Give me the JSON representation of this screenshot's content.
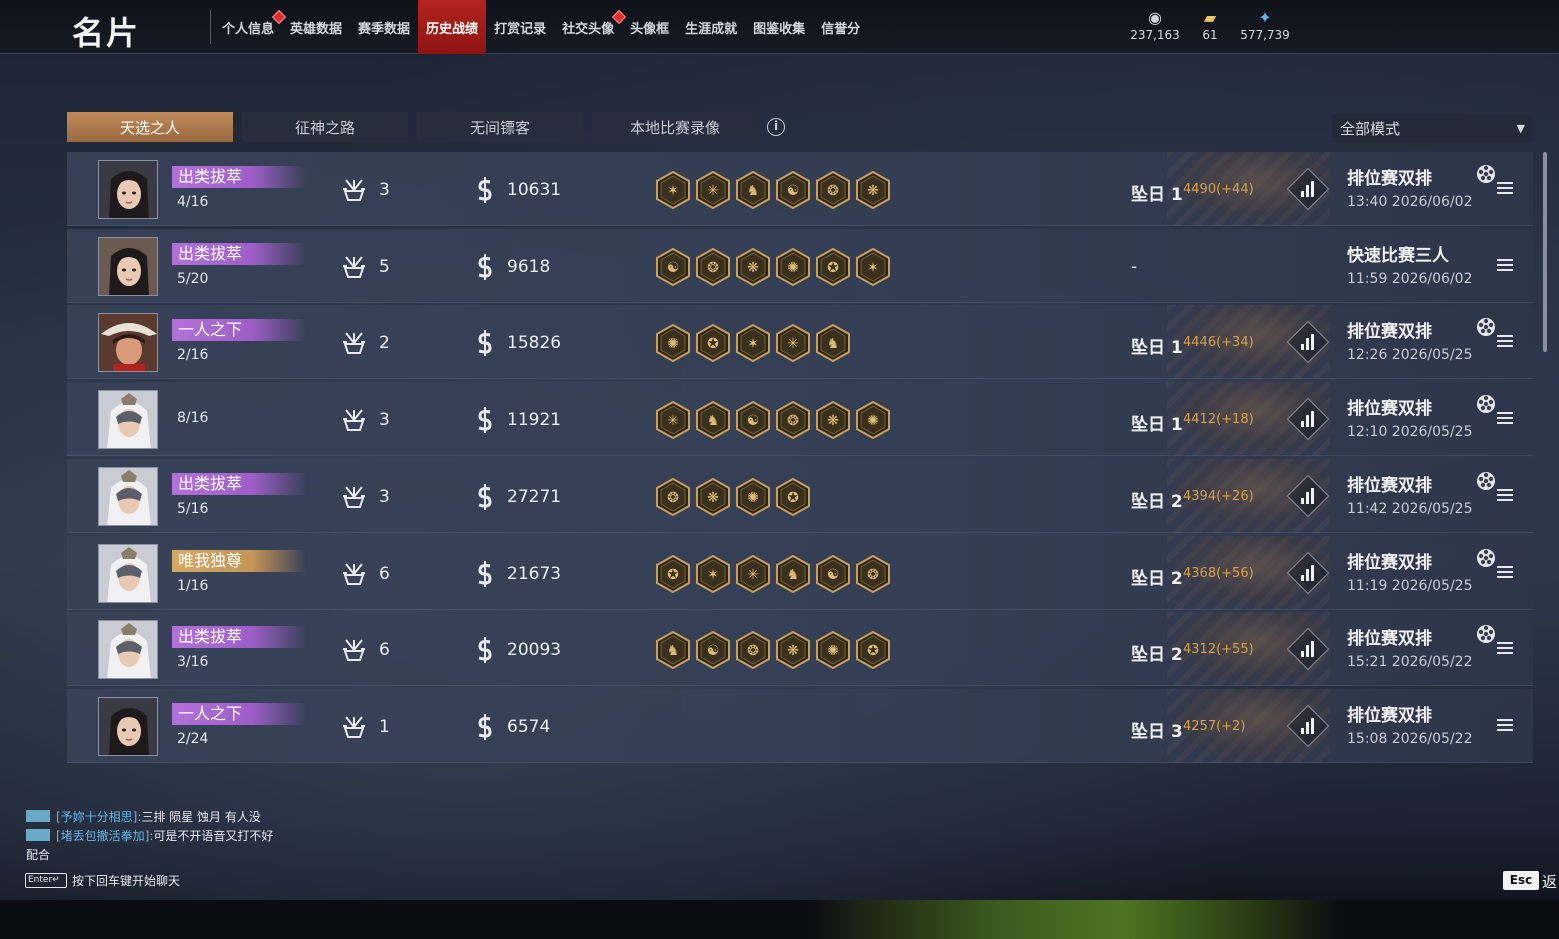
{
  "header": {
    "title": "名片",
    "tabs": [
      {
        "label": "个人信息",
        "badge": true,
        "active": false
      },
      {
        "label": "英雄数据",
        "badge": false,
        "active": false
      },
      {
        "label": "赛季数据",
        "badge": false,
        "active": false
      },
      {
        "label": "历史战绩",
        "badge": false,
        "active": true
      },
      {
        "label": "打赏记录",
        "badge": false,
        "active": false
      },
      {
        "label": "社交头像",
        "badge": true,
        "active": false
      },
      {
        "label": "头像框",
        "badge": false,
        "active": false
      },
      {
        "label": "生涯成就",
        "badge": false,
        "active": false
      },
      {
        "label": "图鉴收集",
        "badge": false,
        "active": false
      },
      {
        "label": "信誉分",
        "badge": false,
        "active": false
      }
    ],
    "currencies": [
      {
        "icon": "gold-coins-icon",
        "value": "237,163"
      },
      {
        "icon": "ticket-icon",
        "value": "61"
      },
      {
        "icon": "feather-crystal-icon",
        "value": "577,739"
      }
    ]
  },
  "subtabs": [
    {
      "label": "天选之人",
      "active": true
    },
    {
      "label": "征神之路",
      "active": false
    },
    {
      "label": "无间镖客",
      "active": false
    },
    {
      "label": "本地比赛录像",
      "active": false
    }
  ],
  "mode_filter": {
    "selected": "全部模式"
  },
  "matches": [
    {
      "tag": "出类拔萃",
      "tag_color": "purple",
      "placement": "4/16",
      "kills": "3",
      "damage": "10631",
      "badges": 6,
      "rank": "坠日 1",
      "score": "4490(+44)",
      "mode": "排位赛双排",
      "time": "13:40  2026/06/02",
      "team": true,
      "avatar": "a1"
    },
    {
      "tag": "出类拔萃",
      "tag_color": "purple",
      "placement": "5/20",
      "kills": "5",
      "damage": "9618",
      "badges": 6,
      "rank": "-",
      "score": "",
      "mode": "快速比赛三人",
      "time": "11:59  2026/06/02",
      "team": false,
      "avatar": "a2"
    },
    {
      "tag": "一人之下",
      "tag_color": "purple",
      "placement": "2/16",
      "kills": "2",
      "damage": "15826",
      "badges": 5,
      "rank": "坠日 1",
      "score": "4446(+34)",
      "mode": "排位赛双排",
      "time": "12:26  2026/05/25",
      "team": true,
      "avatar": "a3"
    },
    {
      "tag": "",
      "tag_color": "none",
      "placement": "8/16",
      "kills": "3",
      "damage": "11921",
      "badges": 6,
      "rank": "坠日 1",
      "score": "4412(+18)",
      "mode": "排位赛双排",
      "time": "12:10  2026/05/25",
      "team": true,
      "avatar": "a4"
    },
    {
      "tag": "出类拔萃",
      "tag_color": "purple",
      "placement": "5/16",
      "kills": "3",
      "damage": "27271",
      "badges": 4,
      "rank": "坠日 2",
      "score": "4394(+26)",
      "mode": "排位赛双排",
      "time": "11:42  2026/05/25",
      "team": true,
      "avatar": "a4"
    },
    {
      "tag": "唯我独尊",
      "tag_color": "gold",
      "placement": "1/16",
      "kills": "6",
      "damage": "21673",
      "badges": 6,
      "rank": "坠日 2",
      "score": "4368(+56)",
      "mode": "排位赛双排",
      "time": "11:19  2026/05/25",
      "team": true,
      "avatar": "a4"
    },
    {
      "tag": "出类拔萃",
      "tag_color": "purple",
      "placement": "3/16",
      "kills": "6",
      "damage": "20093",
      "badges": 6,
      "rank": "坠日 2",
      "score": "4312(+55)",
      "mode": "排位赛双排",
      "time": "15:21  2026/05/22",
      "team": true,
      "avatar": "a4"
    },
    {
      "tag": "一人之下",
      "tag_color": "purple",
      "placement": "2/24",
      "kills": "1",
      "damage": "6574",
      "badges": 0,
      "rank": "坠日 3",
      "score": "4257(+2)",
      "mode": "排位赛双排",
      "time": "15:08  2026/05/22",
      "team": false,
      "avatar": "a1"
    }
  ],
  "chat": {
    "lines": [
      {
        "user": "[予妳十分相思]:",
        "text": "三排 陨星 蚀月 有人没"
      },
      {
        "user": "[堵丢包撤活拳加]:",
        "text": "可是不开语音又打不好"
      },
      {
        "user": "",
        "text": "配合"
      }
    ],
    "enter_label": "Enter↵",
    "hint": "按下回车键开始聊天"
  },
  "footer": {
    "esc_label": "Esc",
    "back_label": "返"
  },
  "colors": {
    "accent_red": "#b3231e",
    "tab_gold": "#c08a5a",
    "score_gold": "#d8a24a",
    "tag_purple": "#b171d9",
    "tag_gold": "#d4a865"
  }
}
